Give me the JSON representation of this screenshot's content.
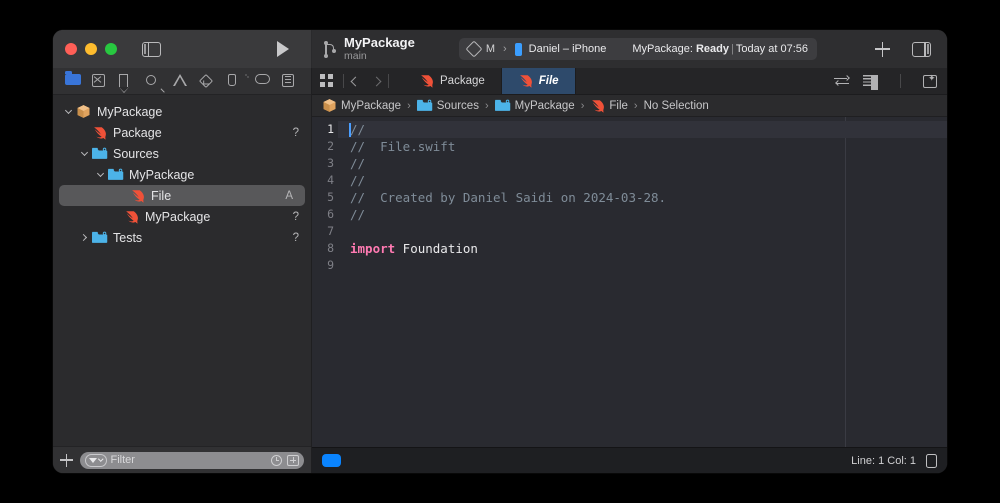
{
  "window": {
    "traffic_lights": [
      "close",
      "minimize",
      "zoom"
    ],
    "sidebar_toggle": "sidebar-toggle-icon",
    "run_button": "run-icon"
  },
  "toolbar": {
    "project_name": "MyPackage",
    "branch": "main",
    "branch_icon": "git-branch-icon",
    "scheme": {
      "icon": "scheme-icon",
      "name": "M",
      "chevron": "›"
    },
    "destination": {
      "icon": "iphone-icon",
      "name": "Daniel – iPhone"
    },
    "status": {
      "prefix": "MyPackage: ",
      "state": "Ready",
      "separator": "|",
      "time": "Today at 07:56"
    },
    "add_button": "plus-icon",
    "inspector_toggle": "inspector-toggle-icon"
  },
  "navigator": {
    "toolbar_icons": [
      {
        "name": "project-navigator-icon",
        "active": true
      },
      {
        "name": "source-control-navigator-icon",
        "active": false
      },
      {
        "name": "bookmark-navigator-icon",
        "active": false
      },
      {
        "name": "find-navigator-icon",
        "active": false
      },
      {
        "name": "issue-navigator-icon",
        "active": false
      },
      {
        "name": "test-navigator-icon",
        "active": false
      },
      {
        "name": "debug-navigator-icon",
        "active": false
      },
      {
        "name": "breakpoint-navigator-icon",
        "active": false
      },
      {
        "name": "report-navigator-icon",
        "active": false
      }
    ],
    "tree": [
      {
        "label": "MyPackage",
        "icon": "package-icon",
        "indent": 0,
        "twisty": "open",
        "status": "",
        "selected": false
      },
      {
        "label": "Package",
        "icon": "swift-icon",
        "indent": 1,
        "twisty": "none",
        "status": "?",
        "selected": false
      },
      {
        "label": "Sources",
        "icon": "source-folder-icon",
        "indent": 1,
        "twisty": "open",
        "status": "",
        "selected": false
      },
      {
        "label": "MyPackage",
        "icon": "source-folder-icon",
        "indent": 2,
        "twisty": "open",
        "status": "",
        "selected": false
      },
      {
        "label": "File",
        "icon": "swift-icon",
        "indent": 3,
        "twisty": "none",
        "status": "A",
        "selected": true
      },
      {
        "label": "MyPackage",
        "icon": "swift-icon",
        "indent": 3,
        "twisty": "none",
        "status": "?",
        "selected": false
      },
      {
        "label": "Tests",
        "icon": "source-folder-icon",
        "indent": 1,
        "twisty": "closed",
        "status": "?",
        "selected": false
      }
    ],
    "filter": {
      "add_label": "plus-icon",
      "placeholder": "Filter",
      "funnel_icon": "filter-funnel-icon",
      "recent_icon": "recent-clock-icon",
      "source_control_icon": "source-control-filter-icon"
    }
  },
  "editor": {
    "nav_icons": {
      "grid": "editor-options-icon",
      "back": "navigate-back-icon",
      "forward": "navigate-forward-icon"
    },
    "tabs": [
      {
        "label": "Package",
        "icon": "swift-icon",
        "active": false
      },
      {
        "label": "File",
        "icon": "swift-icon",
        "active": true
      }
    ],
    "right_icons": {
      "swap": "swap-editor-icon",
      "minimap": "minimap-toggle-icon",
      "add_editor": "add-editor-icon"
    },
    "breadcrumb": [
      {
        "label": "MyPackage",
        "icon": "package-icon"
      },
      {
        "label": "Sources",
        "icon": "source-folder-icon"
      },
      {
        "label": "MyPackage",
        "icon": "source-folder-icon"
      },
      {
        "label": "File",
        "icon": "swift-icon"
      },
      {
        "label": "No Selection",
        "icon": ""
      }
    ],
    "breadcrumb_separator": "›",
    "code": {
      "language": "swift",
      "lines": [
        {
          "n": "1",
          "segments": [
            {
              "t": "//",
              "k": "comment"
            }
          ],
          "current": true
        },
        {
          "n": "2",
          "segments": [
            {
              "t": "//  File.swift",
              "k": "comment"
            }
          ],
          "current": false
        },
        {
          "n": "3",
          "segments": [
            {
              "t": "//",
              "k": "comment"
            }
          ],
          "current": false
        },
        {
          "n": "4",
          "segments": [
            {
              "t": "//",
              "k": "comment"
            }
          ],
          "current": false
        },
        {
          "n": "5",
          "segments": [
            {
              "t": "//  Created by Daniel Saidi on 2024-03-28.",
              "k": "comment"
            }
          ],
          "current": false
        },
        {
          "n": "6",
          "segments": [
            {
              "t": "//",
              "k": "comment"
            }
          ],
          "current": false
        },
        {
          "n": "7",
          "segments": [
            {
              "t": "",
              "k": "plain"
            }
          ],
          "current": false
        },
        {
          "n": "8",
          "segments": [
            {
              "t": "import",
              "k": "kw"
            },
            {
              "t": " Foundation",
              "k": "plain"
            }
          ],
          "current": false
        },
        {
          "n": "9",
          "segments": [
            {
              "t": "",
              "k": "plain"
            }
          ],
          "current": false
        }
      ]
    },
    "status_bar": {
      "activity_indicator": "activity-pill",
      "line_col": "Line: 1  Col: 1",
      "device_icon": "device-preview-icon"
    }
  },
  "colors": {
    "accent_blue": "#0a84ff",
    "active_tab_bg": "#2e4a6b",
    "editor_bg": "#292a30",
    "comment": "#7f8c98",
    "keyword": "#ff7ab2",
    "swift_orange": "#f05138",
    "folder_blue": "#4cb3e8",
    "package_tan": "#e8a85c"
  }
}
